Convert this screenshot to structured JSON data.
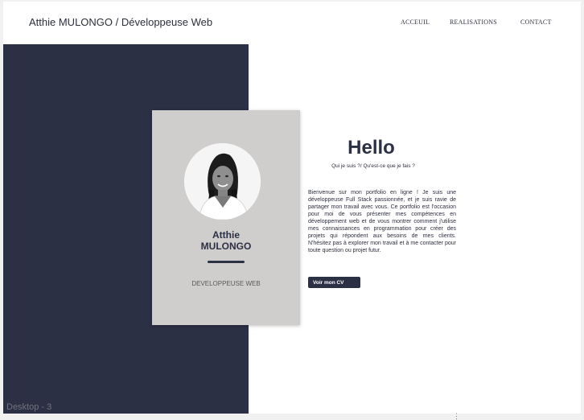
{
  "header": {
    "title": "Atthie MULONGO / Développeuse Web",
    "nav": [
      "ACCEUIL",
      "REALISATIONS",
      "CONTACT"
    ]
  },
  "profile": {
    "first_name": "Atthie",
    "last_name": "MULONGO",
    "role": "DEVELOPPEUSE WEB"
  },
  "intro": {
    "heading": "Hello",
    "subtitle": "Qui je suis ?/ Qu'est-ce que je fais ?",
    "bio": "Bienvenue sur mon portfolio en ligne ! Je suis une développeuse Full Stack passionnée, et je suis ravie de partager mon travail avec vous. Ce portfolio est l'occasion pour moi de vous présenter mes compétences en développement web et de vous montrer comment j'utilise mes connaissances en programmation pour créer des projets qui répondent aux besoins de mes clients. N'hésitez pas à explorer mon travail et à me contacter pour toute question ou projet futur.",
    "button_label": "Voir mon CV"
  },
  "canvas": {
    "frame_label": "Desktop - 3",
    "handle_icon": "⋮"
  },
  "colors": {
    "dark_panel": "#2c3044",
    "card": "#d0cdcd",
    "text": "#2d2f3d"
  }
}
